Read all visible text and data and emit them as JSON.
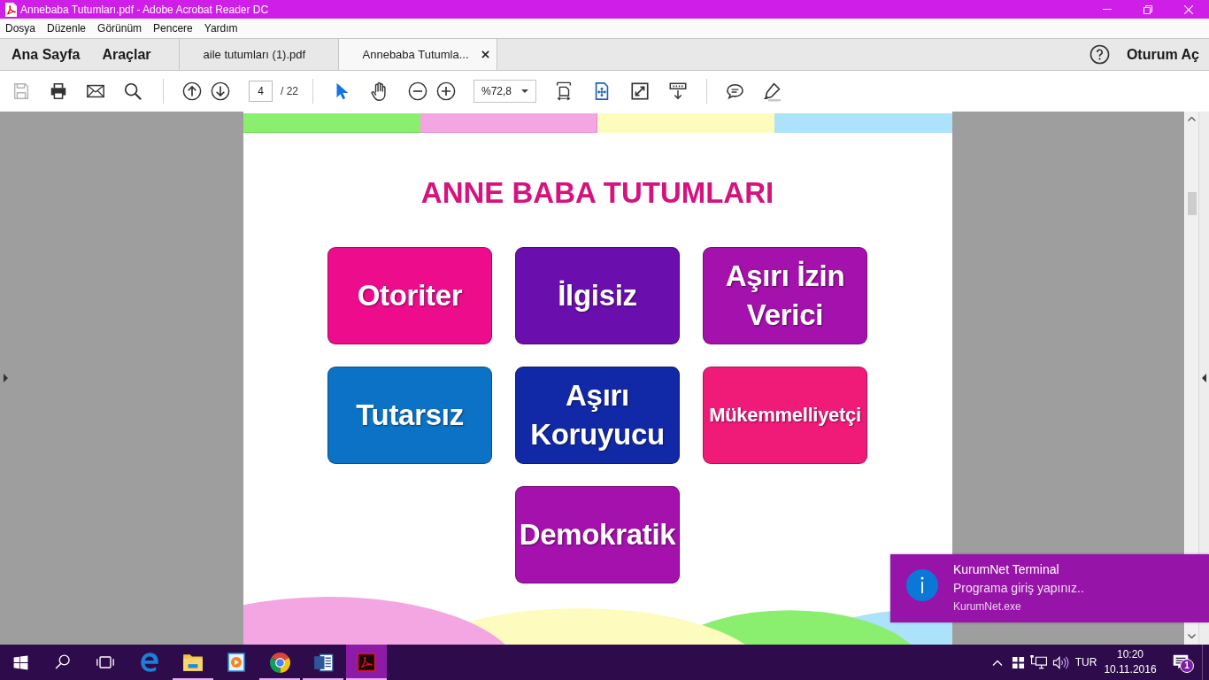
{
  "window": {
    "title": "Annebaba Tutumları.pdf - Adobe Acrobat Reader DC"
  },
  "menu": [
    "Dosya",
    "Düzenle",
    "Görünüm",
    "Pencere",
    "Yardım"
  ],
  "nav": [
    "Ana Sayfa",
    "Araçlar"
  ],
  "tabs": [
    {
      "label": "aile tutumları (1).pdf",
      "selected": false
    },
    {
      "label": "Annebaba Tutumla...",
      "selected": true
    }
  ],
  "sign_in": "Oturum Aç",
  "toolbar": {
    "buttons": [
      {
        "kind": "save",
        "disabled": true
      },
      {
        "kind": "print",
        "disabled": false
      },
      {
        "kind": "email",
        "disabled": false
      },
      {
        "kind": "find",
        "disabled": false
      }
    ],
    "page_field": {
      "value": "4"
    },
    "page_total": "/ 22",
    "tools": [
      {
        "kind": "select",
        "selected": true
      },
      {
        "kind": "hand",
        "selected": false
      }
    ],
    "zoom": {
      "value": "%72,8"
    }
  },
  "page": {
    "heading": "ANNE BABA TUTUMLARI",
    "rows": [
      {
        "cards": [
          {
            "label": "Otoriter",
            "color": "#ec0c8c"
          },
          {
            "label": "İlgisiz",
            "color": "#6a0fae"
          },
          {
            "label": "Aşırı İzin Verici",
            "color": "#a411ac"
          }
        ]
      },
      {
        "cards": [
          {
            "label": "Tutarsız",
            "color": "#0b72c6"
          },
          {
            "label": "Aşırı Koruyucu",
            "color": "#1229a7"
          },
          {
            "label": "Mükemmelliyetçi",
            "color": "#f01a78"
          }
        ]
      },
      {
        "cards": [
          {
            "label": "Demokratik",
            "color": "#a411ac"
          }
        ]
      }
    ]
  },
  "notification": {
    "title": "KurumNet Terminal",
    "message": "Programa giriş yapınız..",
    "source": "KurumNet.exe"
  },
  "taskbar": {
    "apps": [
      {
        "kind": "edge",
        "running": false,
        "active": false
      },
      {
        "kind": "explorer",
        "running": true,
        "active": false
      },
      {
        "kind": "media",
        "running": false,
        "active": false
      },
      {
        "kind": "chrome",
        "running": true,
        "active": false
      },
      {
        "kind": "word",
        "running": true,
        "active": false
      },
      {
        "kind": "acrobat",
        "running": true,
        "active": true
      }
    ],
    "language": "TUR",
    "time": "10:20",
    "date": "10.11.2016",
    "notification_count": "1"
  }
}
